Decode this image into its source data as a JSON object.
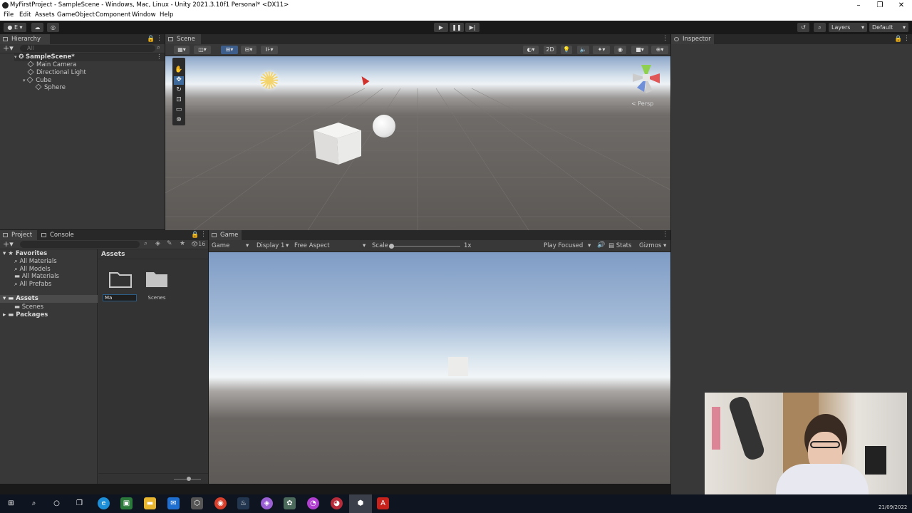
{
  "window": {
    "title": "MyFirstProject - SampleScene - Windows, Mac, Linux - Unity 2021.3.10f1 Personal* <DX11>"
  },
  "menu": [
    "File",
    "Edit",
    "Assets",
    "GameObject",
    "Component",
    "Window",
    "Help"
  ],
  "toolbar": {
    "account_label": "E",
    "layers_label": "Layers",
    "layout_label": "Default"
  },
  "hierarchy": {
    "tab": "Hierarchy",
    "search_placeholder": "All",
    "items": [
      "SampleScene*",
      "Main Camera",
      "Directional Light",
      "Cube",
      "Sphere"
    ]
  },
  "scene": {
    "tab": "Scene",
    "mode_2d": "2D",
    "persp_label": "< Persp"
  },
  "inspector": {
    "tab": "Inspector"
  },
  "project": {
    "tab": "Project",
    "console_tab": "Console",
    "hidden_count": "16",
    "favorites_label": "Favorites",
    "favorites": [
      "All Materials",
      "All Models",
      "All Materials",
      "All Prefabs"
    ],
    "assets_label": "Assets",
    "scenes_label": "Scenes",
    "packages_label": "Packages",
    "breadcrumb": "Assets",
    "rename_value": "Ma",
    "folder_scenes": "Scenes"
  },
  "game": {
    "tab": "Game",
    "view_select": "Game",
    "display": "Display 1",
    "aspect": "Free Aspect",
    "scale_label": "Scale",
    "scale_value": "1x",
    "play_mode": "Play Focused",
    "stats": "Stats",
    "gizmos": "Gizmos"
  },
  "taskbar": {
    "clock": "21/09/2022"
  },
  "colors": {
    "sky_top": "#8aa3c9",
    "horizon": "#e8eef4",
    "ground": "#5d5956",
    "selection": "#2c5d87"
  }
}
